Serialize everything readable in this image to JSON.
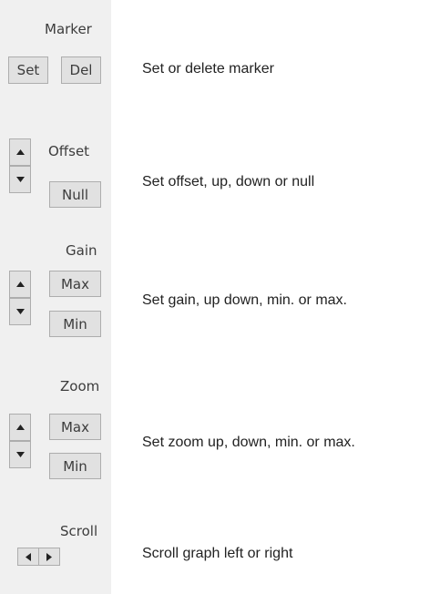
{
  "marker": {
    "label": "Marker",
    "set_label": "Set",
    "del_label": "Del",
    "description": "Set or delete marker"
  },
  "offset": {
    "label": "Offset",
    "null_label": "Null",
    "description": "Set offset, up, down or null"
  },
  "gain": {
    "label": "Gain",
    "max_label": "Max",
    "min_label": "Min",
    "description": "Set gain, up down, min. or max."
  },
  "zoom": {
    "label": "Zoom",
    "max_label": "Max",
    "min_label": "Min",
    "description": "Set zoom up, down, min. or max."
  },
  "scroll": {
    "label": "Scroll",
    "description": "Scroll graph left or right"
  },
  "icons": {
    "up": "arrow-up-icon",
    "down": "arrow-down-icon",
    "left": "arrow-left-icon",
    "right": "arrow-right-icon"
  },
  "colors": {
    "panel_background": "#f0f0f0",
    "button_background": "#e1e1e1",
    "button_border": "#adadad"
  }
}
